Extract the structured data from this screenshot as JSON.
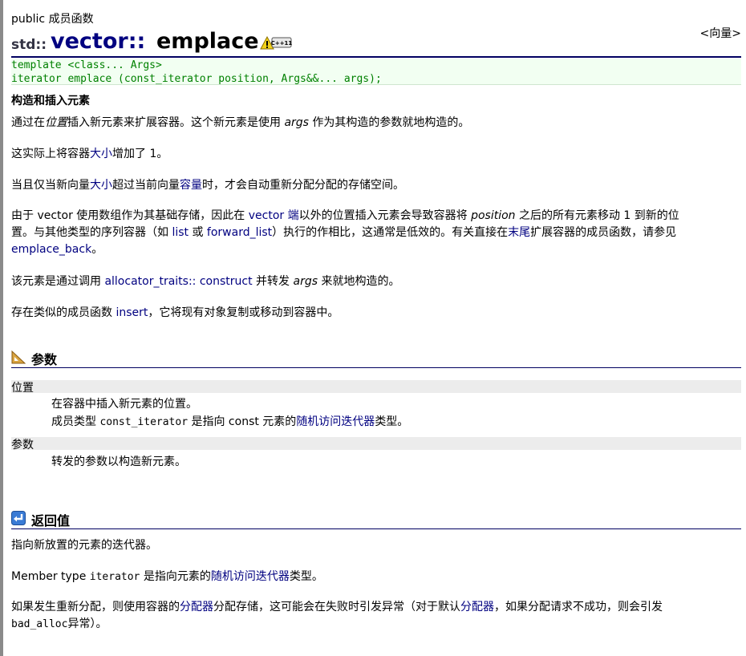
{
  "header": {
    "member_kind": "public 成员函数",
    "up_link": "<向量>",
    "namespace": "std::",
    "class_name": "vector::",
    "function_name": "emplace",
    "badge": "C++11"
  },
  "prototype": {
    "line1": "template <class... Args>",
    "line2": "iterator emplace (const_iterator position, Args&&... args);"
  },
  "description": {
    "heading": "构造和插入元素",
    "p1": {
      "a": "通过在",
      "b": "位置",
      "c": "插入新元素来扩展容器。这个新元素是使用 ",
      "d": "args",
      "e": " 作为其构造的参数就地构造的。"
    },
    "p2": {
      "a": "这实际上将容器",
      "b": "大小",
      "c": "增加了 1。"
    },
    "p3": {
      "a": "当且仅当新向量",
      "b": "大小",
      "c": "超过当前向量",
      "d": "容量",
      "e": "时，才会自动重新分配分配的存储空间。"
    },
    "p4": {
      "a": "由于 vector 使用数组作为其基础存储，因此在 ",
      "b": "vector 端",
      "c": "以外的位置插入元素会导致容器将 ",
      "d": "position",
      "e": " 之后的所有元素移动 1 到新的位",
      "f": "置。与其他类型的序列容器（如 ",
      "g": "list",
      "h": " 或 ",
      "i": "forward_list",
      "j": "）执行的作相比，这通常是低效的。有关直接在",
      "k": "末尾",
      "l": "扩展容器的成员函数，请参见",
      "m": "emplace_back",
      "n": "。"
    },
    "p5": {
      "a": "该元素是通过调用 ",
      "b": "allocator_traits:: construct",
      "c": " 并转发 ",
      "d": "args",
      "e": " 来就地构造的。"
    },
    "p6": {
      "a": "存在类似的成员函数 ",
      "b": "insert",
      "c": "，它将现有对象复制或移动到容器中。"
    }
  },
  "parameters": {
    "heading": "参数",
    "items": [
      {
        "name": "位置",
        "desc1": "在容器中插入新元素的位置。",
        "desc2a": "成员类型 ",
        "desc2b": "const_iterator",
        "desc2c": " 是指向 const 元素的",
        "desc2d": "随机访问迭代器",
        "desc2e": "类型。"
      },
      {
        "name": "参数",
        "desc1": "转发的参数以构造新元素。"
      }
    ]
  },
  "return_value": {
    "heading": "返回值",
    "p1": "指向新放置的元素的迭代器。",
    "p2": {
      "a": "Member type ",
      "b": "iterator",
      "c": " 是指向元素的",
      "d": "随机访问迭代器",
      "e": "类型。"
    },
    "p3": {
      "a": "如果发生重新分配，则使用容器的",
      "b": "分配器",
      "c": "分配存储，这可能会在失败时引发异常（对于默认",
      "d": "分配器",
      "e": "，如果分配请求不成功，则会引发",
      "f": "bad_alloc",
      "g": "异常）。"
    }
  }
}
